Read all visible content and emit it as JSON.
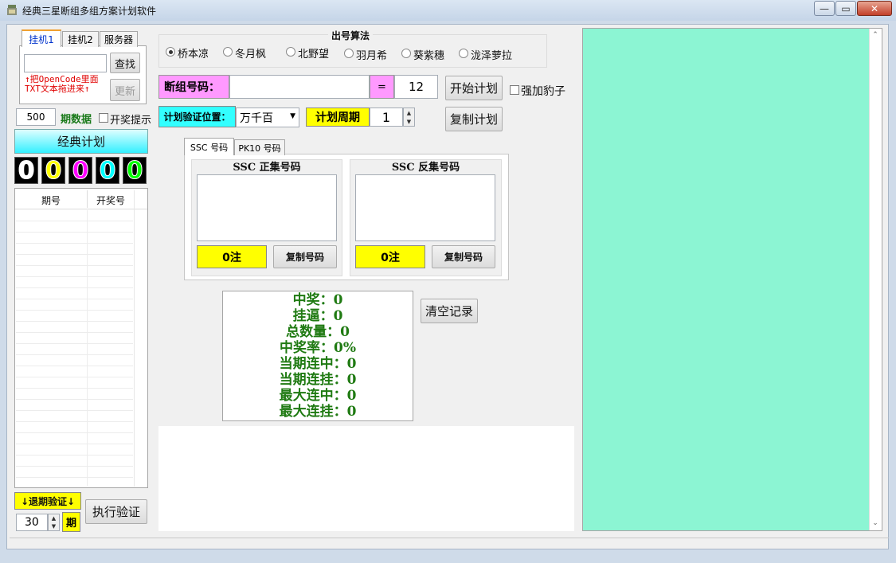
{
  "window": {
    "title": "经典三星断组多组方案计划软件",
    "minimize": "—",
    "restore": "▭",
    "close": "✕"
  },
  "left_tabs": [
    "挂机1",
    "挂机2",
    "服务器"
  ],
  "left_panel": {
    "query_button": "查找",
    "hint_line1": "↑把OpenCode里面",
    "hint_line2": "TXT文本拖进来↑",
    "update_button": "更新",
    "period_count": "500",
    "period_label": "期数据",
    "draw_notice_label": "开奖提示",
    "classic_plan_button": "经典计划",
    "digits": [
      "0",
      "0",
      "0",
      "0",
      "0"
    ],
    "digit_colors": [
      "#ffffff",
      "#ffff00",
      "#ff00ff",
      "#00ffff",
      "#00ff00"
    ],
    "table_headers": [
      "期号",
      "开奖号"
    ],
    "back_verify_label": "↓退期验证↓",
    "back_count": "30",
    "period_unit": "期",
    "execute_button": "执行验证"
  },
  "algorithm": {
    "title": "出号算法",
    "options": [
      "桥本凉",
      "冬月枫",
      "北野望",
      "羽月希",
      "葵紫穗",
      "泷泽萝拉"
    ],
    "selected_index": 0
  },
  "break_group": {
    "label": "断组号码：",
    "value": "",
    "equals": "=",
    "count": "12",
    "start_button": "开始计划",
    "leopard_label": "强加豹子"
  },
  "verify": {
    "position_label": "计划验证位置：",
    "position_value": "万千百",
    "cycle_label": "计划周期",
    "cycle_value": "1",
    "copy_button": "复制计划"
  },
  "code_tabs": [
    "SSC 号码",
    "PK10 号码"
  ],
  "positive_set": {
    "title": "SSC 正集号码",
    "count": "0注",
    "copy_button": "复制号码"
  },
  "negative_set": {
    "title": "SSC 反集号码",
    "count": "0注",
    "copy_button": "复制号码"
  },
  "stats": [
    "中奖：0",
    "挂逼：0",
    "总数量：0",
    "中奖率：0%",
    "当期连中：0",
    "当期连挂：0",
    "最大连中：0",
    "最大连挂：0"
  ],
  "clear_button": "清空记录",
  "colors": {
    "right_panel": "#8cf5d3",
    "yellow": "#ffff00",
    "pink": "#ff99ff",
    "cyan": "#33ffff",
    "stat_green": "#1f7a12"
  }
}
